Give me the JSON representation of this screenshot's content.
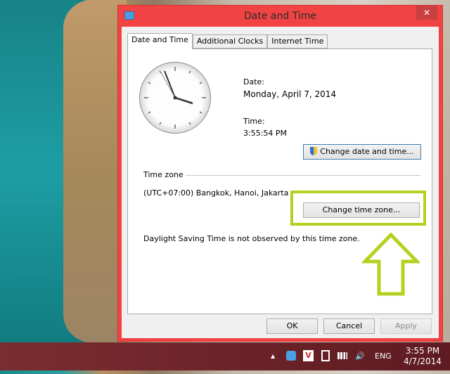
{
  "window": {
    "title": "Date and Time",
    "close": "✕"
  },
  "tabs": [
    {
      "label": "Date and Time",
      "active": true
    },
    {
      "label": "Additional Clocks"
    },
    {
      "label": "Internet Time"
    }
  ],
  "date": {
    "label": "Date:",
    "value": "Monday, April 7, 2014"
  },
  "time": {
    "label": "Time:",
    "value": "3:55:54 PM"
  },
  "change_datetime": "Change date and time...",
  "timezone": {
    "heading": "Time zone",
    "value": "(UTC+07:00) Bangkok, Hanoi, Jakarta",
    "button": "Change time zone..."
  },
  "dst_note": "Daylight Saving Time is not observed by this time zone.",
  "footer": {
    "ok": "OK",
    "cancel": "Cancel",
    "apply": "Apply"
  },
  "taskbar": {
    "language": "ENG",
    "time": "3:55 PM",
    "date": "4/7/2014",
    "tray_up": "▲",
    "volume": "🔊"
  },
  "colors": {
    "title_bar": "#f14343",
    "highlight": "#b5d11f"
  }
}
